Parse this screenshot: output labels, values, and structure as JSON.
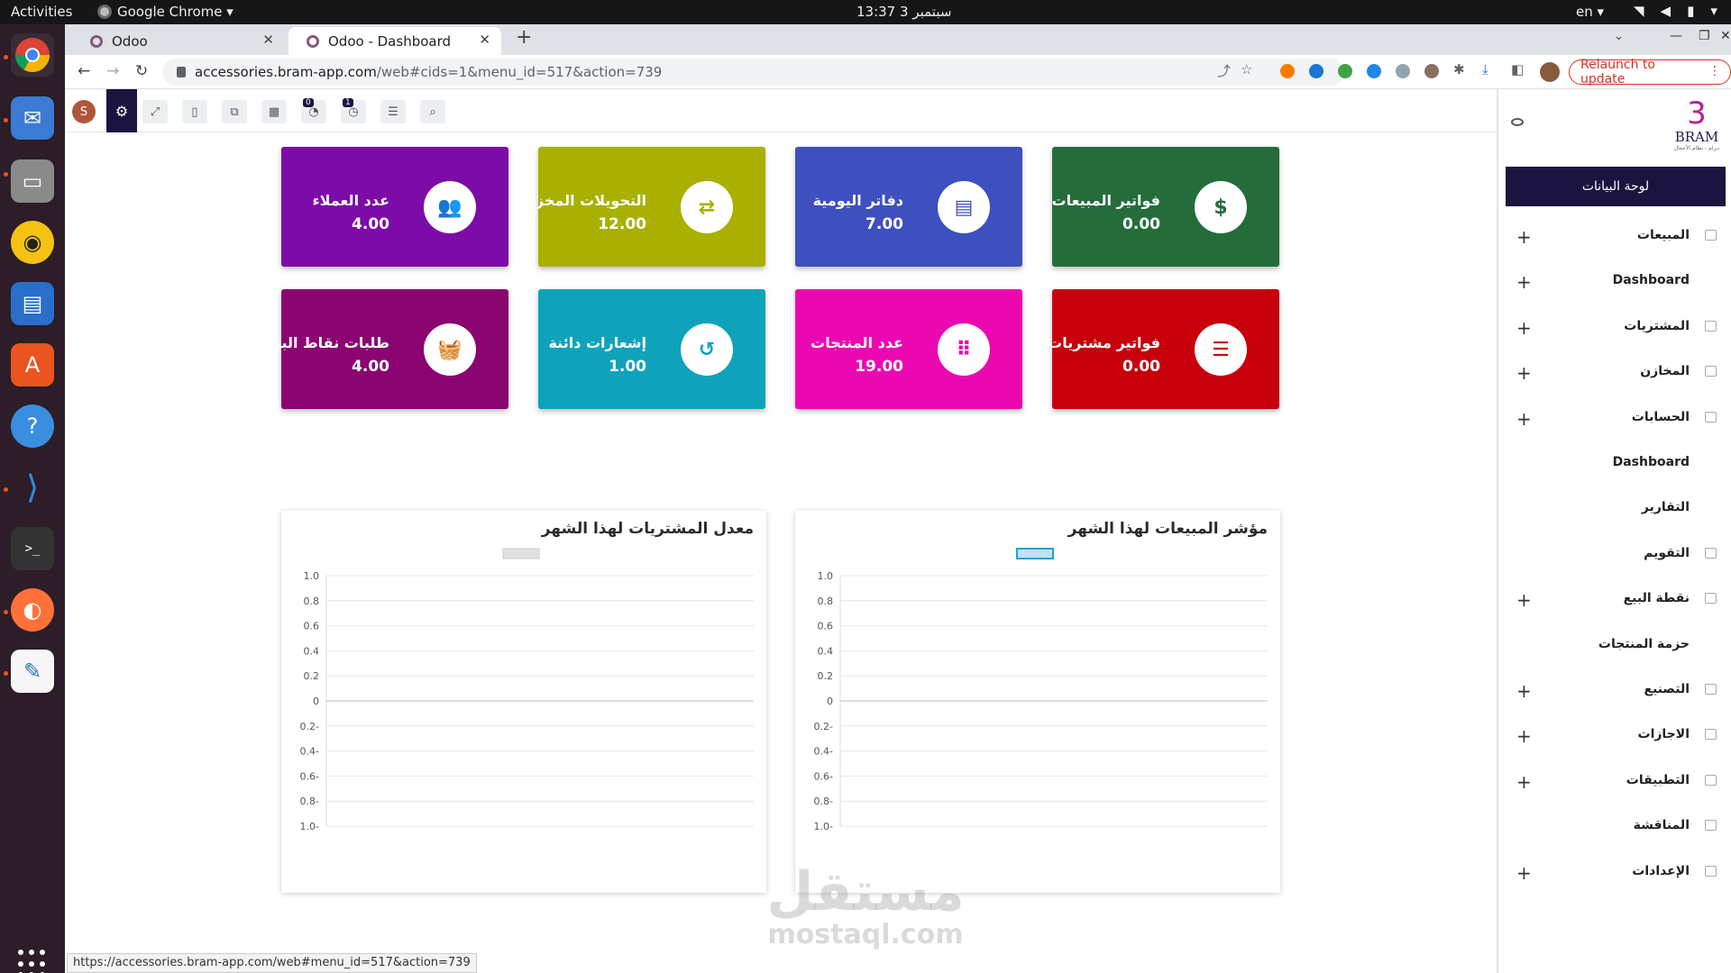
{
  "system_bar": {
    "activities": "Activities",
    "app_name": "Google Chrome ▾",
    "clock": "13:37  3 سبتمبر",
    "lang": "en ▾"
  },
  "browser": {
    "tabs": [
      {
        "label": "Odoo",
        "active": false
      },
      {
        "label": "Odoo - Dashboard",
        "active": true
      }
    ],
    "url_host": "accessories.bram-app.com",
    "url_path": "/web#cids=1&menu_id=517&action=739",
    "relaunch_label": "Relaunch to update",
    "status_url": "https://accessories.bram-app.com/web#menu_id=517&action=739"
  },
  "toolbar": {
    "avatar_letter": "S",
    "badge_chat": "0",
    "badge_activity": "1"
  },
  "cards": [
    {
      "title": "عدد العملاء",
      "value": "4.00",
      "color": "#7c0ba8",
      "icon": "users-icon",
      "glyph": "👥"
    },
    {
      "title": "التحويلات المخزنية",
      "value": "12.00",
      "color": "#a9b000",
      "icon": "transfer-icon",
      "glyph": "⇄"
    },
    {
      "title": "دفاتر اليومية",
      "value": "7.00",
      "color": "#3e4fbf",
      "icon": "journal-icon",
      "glyph": "▤"
    },
    {
      "title": "فواتير المبيعات",
      "value": "0.00",
      "color": "#246d3b",
      "icon": "money-icon",
      "glyph": "$"
    },
    {
      "title": "طلبات نقاط البيع",
      "value": "4.00",
      "color": "#8a0572",
      "icon": "basket-icon",
      "glyph": "🧺"
    },
    {
      "title": "إشعارات دائنة",
      "value": "1.00",
      "color": "#0fa3bb",
      "icon": "undo-icon",
      "glyph": "↺"
    },
    {
      "title": "عدد المنتجات",
      "value": "19.00",
      "color": "#ec08b1",
      "icon": "grid-icon",
      "glyph": "⁞⁞⁞"
    },
    {
      "title": "فواتير مشتريات",
      "value": "0.00",
      "color": "#c8000c",
      "icon": "list-icon",
      "glyph": "☰"
    }
  ],
  "chart_data": [
    {
      "type": "bar",
      "title": "معدل المشتريات لهذا الشهر",
      "categories": [],
      "series": [
        {
          "values": []
        }
      ],
      "ylim": [
        -1,
        1
      ],
      "yticks": [
        "1.0",
        "0.8",
        "0.6",
        "0.4",
        "0.2",
        "0",
        "0.2-",
        "0.4-",
        "0.6-",
        "0.8-",
        "1.0-"
      ],
      "legend": "top",
      "legend_color": "#e0e0e0",
      "grid": true
    },
    {
      "type": "bar",
      "title": "مؤشر المبيعات لهذا الشهر",
      "categories": [],
      "series": [
        {
          "values": []
        }
      ],
      "ylim": [
        -1,
        1
      ],
      "yticks": [
        "1.0",
        "0.8",
        "0.6",
        "0.4",
        "0.2",
        "0",
        "0.2-",
        "0.4-",
        "0.6-",
        "0.8-",
        "1.0-"
      ],
      "legend": "top",
      "legend_color": "#bfe3f3",
      "grid": true
    }
  ],
  "sidebar": {
    "logo_mark": "3",
    "logo_text": "BRAM",
    "logo_tagline": "بـرام - نظام الأعمال",
    "header": "لوحة البيانات",
    "items": [
      {
        "label": "المبيعات",
        "expandable": true,
        "icon": "chart-icon"
      },
      {
        "label": "Dashboard",
        "expandable": true,
        "icon": ""
      },
      {
        "label": "المشتريات",
        "expandable": true,
        "icon": "card-icon"
      },
      {
        "label": "المخازن",
        "expandable": true,
        "icon": "box-icon"
      },
      {
        "label": "الحسابات",
        "expandable": true,
        "icon": "ledger-icon"
      },
      {
        "label": "Dashboard",
        "expandable": false,
        "icon": ""
      },
      {
        "label": "التقارير",
        "expandable": false,
        "icon": ""
      },
      {
        "label": "التقويم",
        "expandable": false,
        "icon": "calendar-icon"
      },
      {
        "label": "نقطة البيع",
        "expandable": true,
        "icon": "store-icon"
      },
      {
        "label": "حزمة المنتجات",
        "expandable": false,
        "icon": ""
      },
      {
        "label": "التصنيع",
        "expandable": true,
        "icon": "wrench-icon"
      },
      {
        "label": "الاجازات",
        "expandable": true,
        "icon": "suitcase-icon"
      },
      {
        "label": "التطبيقات",
        "expandable": true,
        "icon": "apps-icon"
      },
      {
        "label": "المناقشة",
        "expandable": false,
        "icon": "chat-icon"
      },
      {
        "label": "الإعدادات",
        "expandable": true,
        "icon": "settings-icon"
      }
    ]
  },
  "watermark": {
    "ar": "مستقل",
    "en": "mostaql.com"
  }
}
